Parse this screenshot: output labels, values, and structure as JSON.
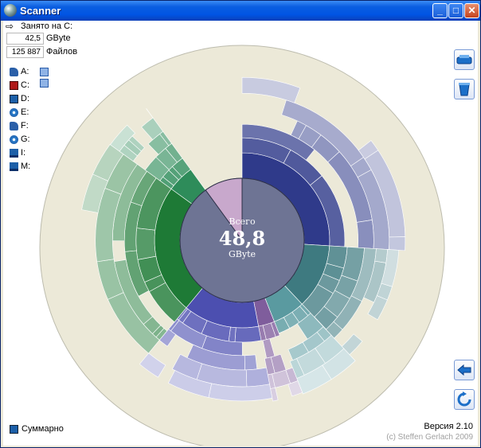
{
  "window": {
    "title": "Scanner"
  },
  "stats": {
    "occupied_label": "Занято на C:",
    "size_value": "42,5",
    "size_unit": "GByte",
    "files_value": "125 887",
    "files_label": "Файлов"
  },
  "drives": [
    {
      "label": "A:",
      "icon": "floppy-drive-icon"
    },
    {
      "label": "C:",
      "icon": "hard-drive-icon"
    },
    {
      "label": "D:",
      "icon": "cd-drive-icon"
    },
    {
      "label": "E:",
      "icon": "cd-drive-icon"
    },
    {
      "label": "F:",
      "icon": "floppy-drive-icon"
    },
    {
      "label": "G:",
      "icon": "cd-drive-icon"
    },
    {
      "label": "I:",
      "icon": "network-drive-icon"
    },
    {
      "label": "M:",
      "icon": "network-drive-icon"
    }
  ],
  "center": {
    "caption": "Всего",
    "value": "48,8",
    "unit": "GByte"
  },
  "footer": {
    "summary_label": "Суммарно",
    "version": "Версия 2.10",
    "copyright": "(c) Steffen Gerlach 2009"
  },
  "side_buttons": [
    "scan-drive-icon",
    "delete-bin-icon",
    "back-arrow-icon",
    "refresh-icon"
  ],
  "colors": {
    "titlebar": "#0054e3",
    "center_disk": "#6e7494",
    "free_space": "#c8a8cc",
    "ring_bg": "#ece9d8"
  },
  "chart_data": {
    "type": "sunburst",
    "total": "48,8 GByte",
    "segments": [
      {
        "color": "#2f3a8a",
        "share": 0.26
      },
      {
        "color": "#3e7a80",
        "share": 0.12
      },
      {
        "color": "#5a9aa0",
        "share": 0.06
      },
      {
        "color": "#7f5d9c",
        "share": 0.03
      },
      {
        "color": "#4c4fb0",
        "share": 0.14
      },
      {
        "color": "#1e7a36",
        "share": 0.24
      },
      {
        "color": "#2e8c5a",
        "share": 0.05
      },
      {
        "color": "#c8a8cc",
        "share": 0.1
      }
    ]
  }
}
